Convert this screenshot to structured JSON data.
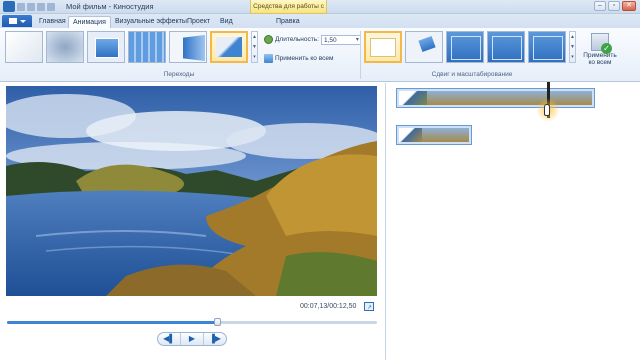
{
  "window": {
    "title": "Мой фильм - Киностудия",
    "contextual_group": "Средства для работы с видео",
    "buttons": {
      "minimize": "–",
      "maximize": "▫",
      "close": "✕"
    }
  },
  "tabs": [
    {
      "label": "Главная",
      "active": false
    },
    {
      "label": "Анимация",
      "active": true
    },
    {
      "label": "Визуальные эффекты",
      "active": false
    },
    {
      "label": "Проект",
      "active": false
    },
    {
      "label": "Вид",
      "active": false
    },
    {
      "label": "Правка",
      "active": false,
      "contextual": true
    }
  ],
  "ribbon": {
    "transitions_group_label": "Переходы",
    "pan_zoom_group_label": "Сдвиг и масштабирование",
    "duration_label": "Длительность:",
    "duration_value": "1,50",
    "apply_all_label": "Применить ко всем",
    "apply_all_big_label_1": "Применить",
    "apply_all_big_label_2": "ко всем"
  },
  "preview": {
    "timecode": "00:07,13/00:12,50",
    "seek_progress": 0.57,
    "controls": {
      "prev": "◀▌",
      "play": "▶",
      "next": "▐▶"
    }
  },
  "colors": {
    "accent": "#3c84d4",
    "selected_border": "#f2b84b",
    "ribbon_bg": "#e6eef9"
  },
  "icons": {
    "duration": "clock-icon",
    "apply_all": "apply-all-icon",
    "fullscreen": "fullscreen-icon"
  }
}
